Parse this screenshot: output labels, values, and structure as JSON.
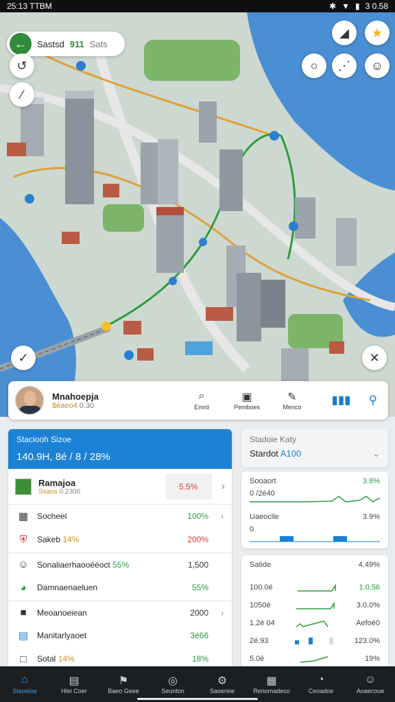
{
  "status_bar": {
    "time": "25:13 TTBM",
    "right_text": "3 0.58"
  },
  "map": {
    "search_main": "Sastsd",
    "search_green": "911",
    "search_gray": "Sats"
  },
  "profile": {
    "name": "Mnahoepja",
    "sub_gold": "$éaeo4",
    "sub_rest": "0.30",
    "actions": [
      {
        "icon": "search-icon",
        "glyph": "⌕",
        "label": "Emrd"
      },
      {
        "icon": "tv-icon",
        "glyph": "▣",
        "label": "Pemboes"
      },
      {
        "icon": "pen-icon",
        "glyph": "✎",
        "label": "Menco"
      }
    ]
  },
  "left_panel": {
    "header_title": "Staciooh Sizoe",
    "header_value": "140.9H, 8é / 8 / 28%",
    "first_row": {
      "name": "Ramajoa",
      "sub_gold": "Ssaos",
      "sub_rest": "0.2306",
      "badge": "5.5%"
    },
    "rows": [
      {
        "icon": "calendar-icon",
        "glyph": "▦",
        "label": "Socheel",
        "label_color": "",
        "value": "100%",
        "value_color": "green",
        "arrow": "›",
        "sep": false
      },
      {
        "icon": "shield-icon",
        "glyph": "⛨",
        "label": "Sakeb",
        "label_color_text": "14%",
        "label_color": "gold",
        "value": "200%",
        "value_color": "red",
        "arrow": "",
        "sep": false
      },
      {
        "icon": "person-icon",
        "glyph": "☺",
        "label": "Sonaliaerhaooééoct",
        "label_color_text": "55%",
        "label_color": "green",
        "value": "1,500",
        "value_color": "dark",
        "arrow": "",
        "sep": true
      },
      {
        "icon": "android-icon",
        "glyph": "◕",
        "label": "Damnaenaeluen",
        "label_color": "",
        "value": "55%",
        "value_color": "green",
        "arrow": "",
        "sep": false
      },
      {
        "icon": "chat-icon",
        "glyph": "■",
        "label": "Meoanoeiean",
        "label_color": "",
        "value": "2000",
        "value_color": "dark",
        "arrow": "›",
        "sep": true
      },
      {
        "icon": "document-icon",
        "glyph": "▤",
        "label": "Manitarlyaoet",
        "label_color": "",
        "value": "3é66",
        "value_color": "green",
        "arrow": "",
        "sep": false
      },
      {
        "icon": "box-icon",
        "glyph": "□",
        "label": "Sotal",
        "label_color_text": "14%",
        "label_color": "gold",
        "value": "18%",
        "value_color": "green",
        "arrow": "",
        "sep": false
      }
    ]
  },
  "right_top": {
    "title": "Stadoie Katy",
    "label": "Stardot",
    "value": "A100"
  },
  "chart_cards": [
    {
      "label": "Sooaort",
      "value": "3.8%",
      "sub": "0 /2é40",
      "color": "#2e9a42"
    },
    {
      "label": "Uaeocile",
      "value": "3.9%",
      "sub": "0",
      "color": "#1b82d5"
    }
  ],
  "stats_card": {
    "title": "Satide",
    "title_value": "4.49%",
    "rows": [
      {
        "left": "100.0é",
        "right": "1.0.56"
      },
      {
        "left": "1050é",
        "right": "3.0.0%"
      },
      {
        "left": "1.2é 04",
        "right": "Aefoé0"
      },
      {
        "left": "2é.93",
        "right": "123.0%"
      },
      {
        "left": "5.0é",
        "right": "19%"
      }
    ]
  },
  "nav": [
    {
      "icon": "home-icon",
      "glyph": "⌂",
      "label": "Staoeioe",
      "active": true
    },
    {
      "icon": "calendar-icon",
      "glyph": "▤",
      "label": "Hlei Coer",
      "active": false
    },
    {
      "icon": "flag-icon",
      "glyph": "⚑",
      "label": "Baeo Geee",
      "active": false
    },
    {
      "icon": "target-icon",
      "glyph": "◎",
      "label": "Seunton",
      "active": false
    },
    {
      "icon": "gear-icon",
      "glyph": "⚙",
      "label": "Saoereie",
      "active": false
    },
    {
      "icon": "grid-icon",
      "glyph": "▦",
      "label": "Renomadeco",
      "active": false
    },
    {
      "icon": "chat-icon",
      "glyph": "◔",
      "label": "Ceoadoe",
      "active": false
    },
    {
      "icon": "user-icon",
      "glyph": "☺",
      "label": "Aoaecoue",
      "active": false
    }
  ]
}
